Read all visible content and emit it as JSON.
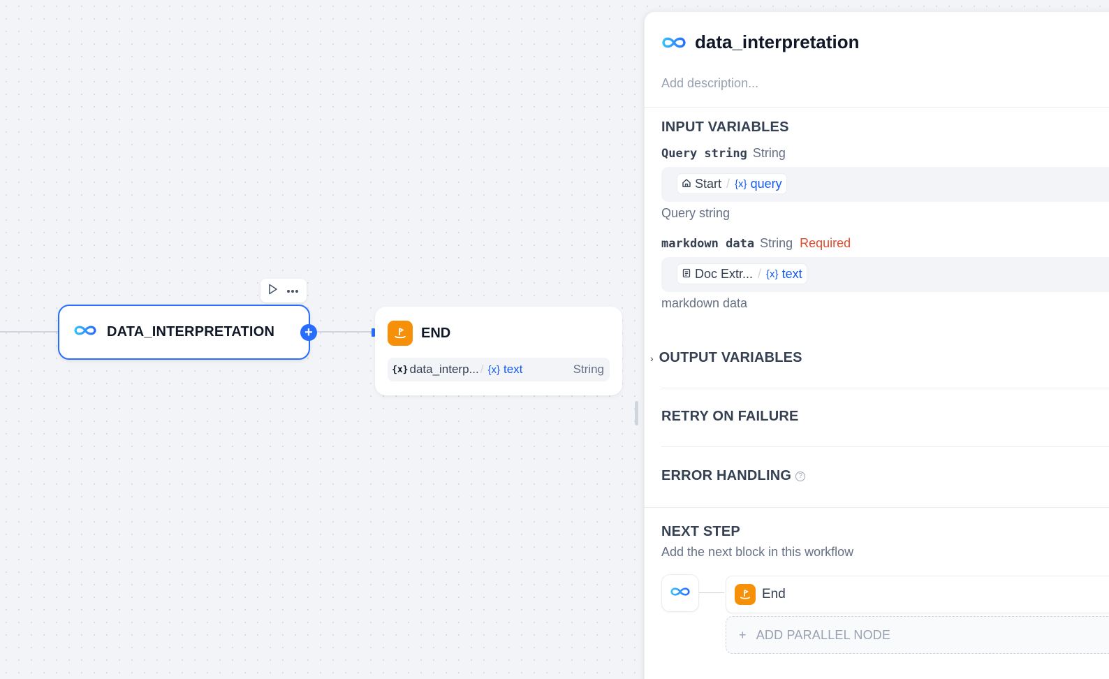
{
  "canvas": {
    "llm_node": {
      "title": "DATA_INTERPRETATION",
      "icon": "infinity-icon"
    },
    "end_node": {
      "title": "END",
      "icon": "end-flag-icon",
      "variable": {
        "x_label": "{x}",
        "source": "data_interp...",
        "sep": "/",
        "x_tag": "{x}",
        "name": "text",
        "type": "String"
      }
    },
    "toolbar": {
      "run_icon": "play-icon",
      "more_icon": "more-horizontal-icon"
    }
  },
  "panel": {
    "title": "data_interpretation",
    "description_placeholder": "Add description...",
    "input_section_title": "INPUT VARIABLES",
    "inputs": [
      {
        "name": "Query string",
        "type": "String",
        "required": "",
        "chip": {
          "node": "Start",
          "sep": "/",
          "x_tag": "{x}",
          "var": "query",
          "icon": "home-icon"
        },
        "help": "Query string"
      },
      {
        "name": "markdown data",
        "type": "String",
        "required": "Required",
        "chip": {
          "node": "Doc Extr...",
          "sep": "/",
          "x_tag": "{x}",
          "var": "text",
          "icon": "document-icon"
        },
        "help": "markdown data"
      }
    ],
    "output_section_title": "OUTPUT VARIABLES",
    "retry_section_title": "RETRY ON FAILURE",
    "error_section_title": "ERROR HANDLING",
    "next_step": {
      "title": "NEXT STEP",
      "subtitle": "Add the next block in this workflow",
      "next_node_label": "End",
      "add_parallel_label": "ADD PARALLEL NODE",
      "add_symbol": "+"
    }
  },
  "colors": {
    "accent": "#296dff",
    "end_orange": "#f79009",
    "required_red": "#e14b2a"
  }
}
